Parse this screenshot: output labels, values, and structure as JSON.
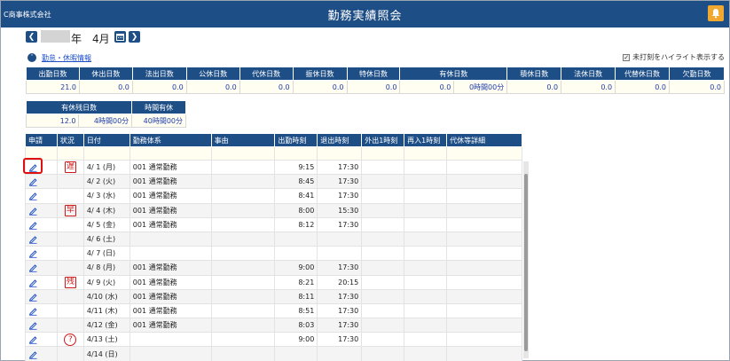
{
  "header": {
    "company": "C商事株式会社",
    "title": "勤務実績照会"
  },
  "period": {
    "year_suffix": "年",
    "month": "4月"
  },
  "summary_toggle": {
    "link_label": "勤怠・休暇情報"
  },
  "highlight": {
    "label": "未打刻をハイライト表示する",
    "checked": true
  },
  "summary1": {
    "headers": [
      "出勤日数",
      "休出日数",
      "法出日数",
      "公休日数",
      "代休日数",
      "振休日数",
      "特休日数",
      "有休日数",
      "積休日数",
      "法休日数",
      "代替休日数",
      "欠勤日数"
    ],
    "values": [
      "21.0",
      "0.0",
      "0.0",
      "0.0",
      "0.0",
      "0.0",
      "0.0",
      "0.0",
      "0時間00分",
      "0.0",
      "0.0",
      "0.0",
      "0.0"
    ]
  },
  "summary2": {
    "headers": [
      "有休残日数",
      "時間有休"
    ],
    "values": [
      "12.0",
      "4時間00分",
      "40時間00分"
    ]
  },
  "attendance": {
    "headers": [
      "申請",
      "状況",
      "日付",
      "勤務体系",
      "事由",
      "出勤時刻",
      "退出時刻",
      "外出1時刻",
      "再入1時刻",
      "代休等詳細"
    ],
    "rows": [
      {
        "status": "遅",
        "date": "4/ 1 (月)",
        "day": "weekday",
        "schedule": "001 通常勤務",
        "in": "9:15",
        "out": "17:30"
      },
      {
        "status": "",
        "date": "4/ 2 (火)",
        "day": "weekday",
        "schedule": "001 通常勤務",
        "in": "8:45",
        "out": "17:30"
      },
      {
        "status": "",
        "date": "4/ 3 (水)",
        "day": "weekday",
        "schedule": "001 通常勤務",
        "in": "8:41",
        "out": "17:30"
      },
      {
        "status": "早",
        "date": "4/ 4 (木)",
        "day": "weekday",
        "schedule": "001 通常勤務",
        "in": "8:00",
        "out": "15:30"
      },
      {
        "status": "",
        "date": "4/ 5 (金)",
        "day": "weekday",
        "schedule": "001 通常勤務",
        "in": "8:12",
        "out": "17:30"
      },
      {
        "status": "",
        "date": "4/ 6 (土)",
        "day": "sat",
        "schedule": "",
        "in": "",
        "out": ""
      },
      {
        "status": "",
        "date": "4/ 7 (日)",
        "day": "sun",
        "schedule": "",
        "in": "",
        "out": ""
      },
      {
        "status": "",
        "date": "4/ 8 (月)",
        "day": "weekday",
        "schedule": "001 通常勤務",
        "in": "9:00",
        "out": "17:30"
      },
      {
        "status": "残",
        "date": "4/ 9 (火)",
        "day": "weekday",
        "schedule": "001 通常勤務",
        "in": "8:21",
        "out": "20:15"
      },
      {
        "status": "",
        "date": "4/10 (水)",
        "day": "weekday",
        "schedule": "001 通常勤務",
        "in": "8:11",
        "out": "17:30"
      },
      {
        "status": "",
        "date": "4/11 (木)",
        "day": "weekday",
        "schedule": "001 通常勤務",
        "in": "8:51",
        "out": "17:30"
      },
      {
        "status": "",
        "date": "4/12 (金)",
        "day": "weekday",
        "schedule": "001 通常勤務",
        "in": "8:03",
        "out": "17:30"
      },
      {
        "status": "?",
        "date": "4/13 (土)",
        "day": "sat",
        "schedule": "",
        "in": "9:00",
        "out": "17:30"
      },
      {
        "status": "",
        "date": "4/14 (日)",
        "day": "sun",
        "schedule": "",
        "in": "",
        "out": ""
      }
    ]
  },
  "colors": {
    "header_bg": "#1e4e86",
    "bell": "#f0a830",
    "highlight_border": "#e01010",
    "status_red": "#d01818"
  }
}
